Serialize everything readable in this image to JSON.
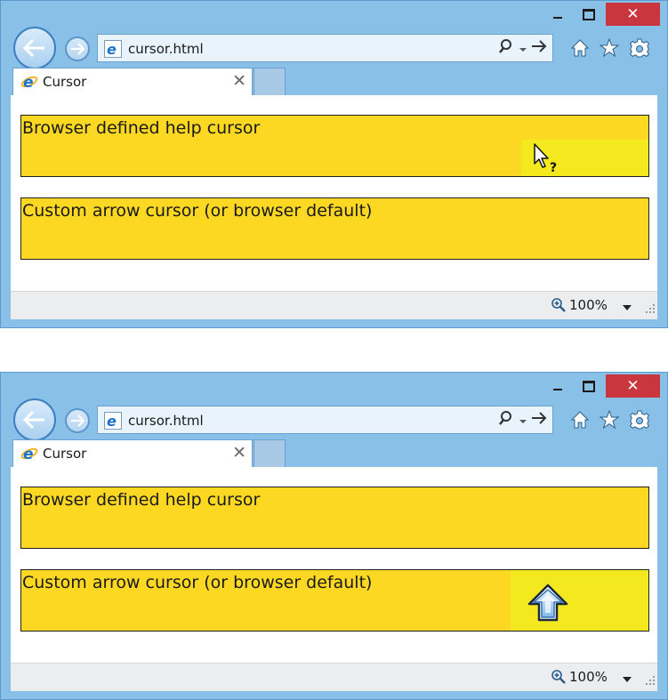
{
  "colors": {
    "frame": "#88c0e8",
    "close_button": "#c9363d",
    "box_fill": "#fcd823",
    "cursor_highlight": "#f3e91e"
  },
  "windows": [
    {
      "caption": {
        "minimize_icon": "minimize-icon",
        "maximize_icon": "maximize-icon",
        "close_label": "✕"
      },
      "address_bar": {
        "url": "cursor.html"
      },
      "tab": {
        "title": "Cursor",
        "close_label": "✕"
      },
      "boxes": [
        {
          "label": "Browser defined help cursor"
        },
        {
          "label": "Custom arrow cursor (or browser default)"
        }
      ],
      "cursor": {
        "name": "help-cursor-icon",
        "over_box": 1
      },
      "status": {
        "zoom": "100%"
      }
    },
    {
      "caption": {
        "minimize_icon": "minimize-icon",
        "maximize_icon": "maximize-icon",
        "close_label": "✕"
      },
      "address_bar": {
        "url": "cursor.html"
      },
      "tab": {
        "title": "Cursor",
        "close_label": "✕"
      },
      "boxes": [
        {
          "label": "Browser defined help cursor"
        },
        {
          "label": "Custom arrow cursor (or browser default)"
        }
      ],
      "cursor": {
        "name": "custom-up-arrow-cursor-icon",
        "over_box": 2
      },
      "status": {
        "zoom": "100%"
      }
    }
  ]
}
